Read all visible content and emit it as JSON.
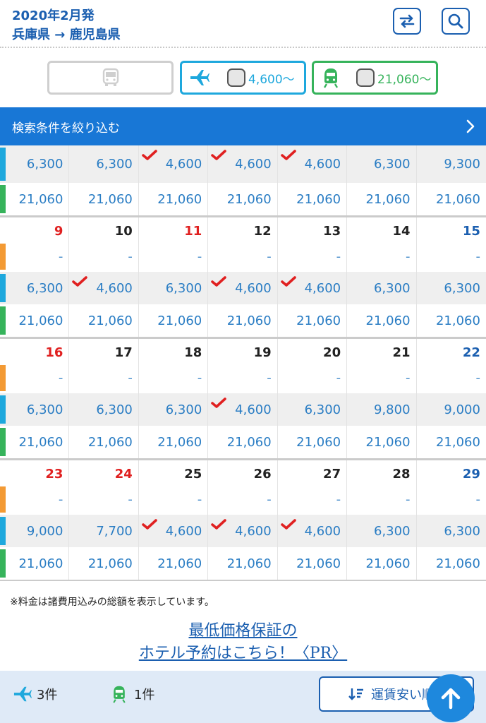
{
  "header": {
    "date_line": "2020年2月発",
    "route_line": "兵庫県 → 鹿児島県"
  },
  "modes": {
    "air_price": "4,600〜",
    "rail_price": "21,060〜"
  },
  "filter": {
    "label": "検索条件を絞り込む"
  },
  "calendar": {
    "top": {
      "air": [
        "6,300",
        "6,300",
        "4,600",
        "4,600",
        "4,600",
        "6,300",
        "9,300"
      ],
      "air_check": [
        false,
        false,
        true,
        true,
        true,
        false,
        false
      ],
      "rail": [
        "21,060",
        "21,060",
        "21,060",
        "21,060",
        "21,060",
        "21,060",
        "21,060"
      ]
    },
    "weeks": [
      {
        "dates": [
          "9",
          "10",
          "11",
          "12",
          "13",
          "14",
          "15"
        ],
        "date_color": [
          "sun",
          "",
          "sun",
          "",
          "",
          "",
          "sat"
        ],
        "bus": [
          "-",
          "-",
          "-",
          "-",
          "-",
          "-",
          "-"
        ],
        "air": [
          "6,300",
          "4,600",
          "6,300",
          "4,600",
          "4,600",
          "6,300",
          "6,300"
        ],
        "air_check": [
          false,
          true,
          false,
          true,
          true,
          false,
          false
        ],
        "rail": [
          "21,060",
          "21,060",
          "21,060",
          "21,060",
          "21,060",
          "21,060",
          "21,060"
        ]
      },
      {
        "dates": [
          "16",
          "17",
          "18",
          "19",
          "20",
          "21",
          "22"
        ],
        "date_color": [
          "sun",
          "",
          "",
          "",
          "",
          "",
          "sat"
        ],
        "bus": [
          "-",
          "-",
          "-",
          "-",
          "-",
          "-",
          "-"
        ],
        "air": [
          "6,300",
          "6,300",
          "6,300",
          "4,600",
          "6,300",
          "9,800",
          "9,000"
        ],
        "air_check": [
          false,
          false,
          false,
          true,
          false,
          false,
          false
        ],
        "rail": [
          "21,060",
          "21,060",
          "21,060",
          "21,060",
          "21,060",
          "21,060",
          "21,060"
        ]
      },
      {
        "dates": [
          "23",
          "24",
          "25",
          "26",
          "27",
          "28",
          "29"
        ],
        "date_color": [
          "sun",
          "sun",
          "",
          "",
          "",
          "",
          "sat"
        ],
        "bus": [
          "-",
          "-",
          "-",
          "-",
          "-",
          "-",
          "-"
        ],
        "air": [
          "9,000",
          "7,700",
          "4,600",
          "4,600",
          "4,600",
          "6,300",
          "6,300"
        ],
        "air_check": [
          false,
          false,
          true,
          true,
          true,
          false,
          false
        ],
        "rail": [
          "21,060",
          "21,060",
          "21,060",
          "21,060",
          "21,060",
          "21,060",
          "21,060"
        ]
      }
    ]
  },
  "note": "※料金は諸費用込みの総額を表示しています。",
  "pr": {
    "line1": "最低価格保証の",
    "line2": "ホテル予約はこちら！〈PR〉"
  },
  "footer": {
    "air_count": "3件",
    "rail_count": "1件",
    "sort_label": "運賃安い順"
  },
  "icons": [
    "swap-icon",
    "search-icon",
    "bus-icon",
    "plane-icon",
    "train-icon",
    "checkmark-icon",
    "chevron-right-icon",
    "sort-icon",
    "arrow-up-icon"
  ],
  "colors": {
    "brand_blue": "#1877d6",
    "air": "#1ea8dd",
    "rail": "#36b35b",
    "bus": "#f39a34",
    "sunday": "#e02020",
    "saturday": "#1b5fb0"
  }
}
